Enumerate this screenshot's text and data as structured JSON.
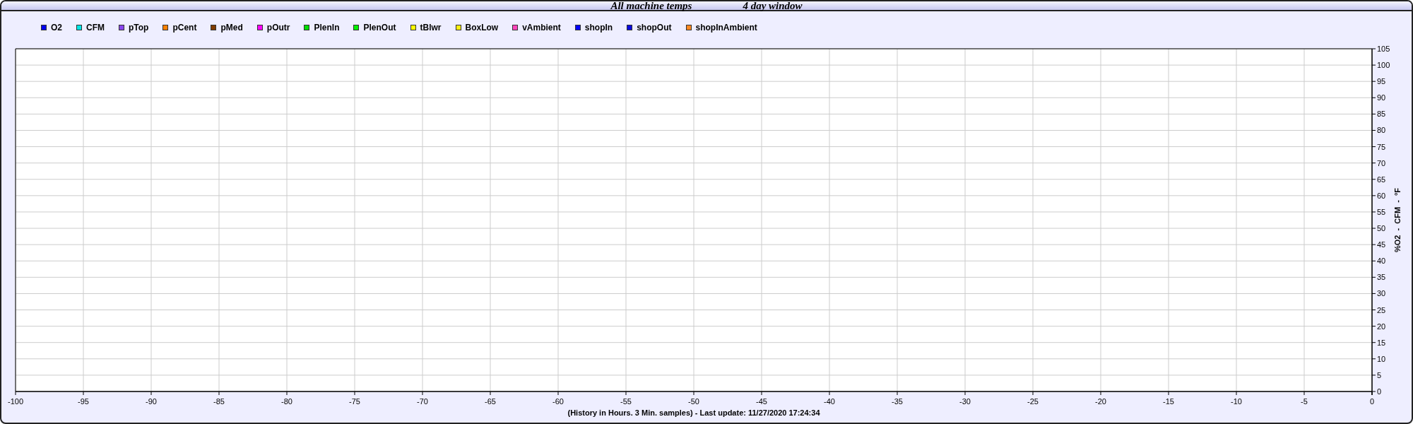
{
  "title": {
    "parts": [
      "All machine temps",
      "4 day window"
    ]
  },
  "chart_data": {
    "type": "line",
    "xlabel": "(History in Hours. 3 Min. samples) - Last update: 11/27/2020 17:24:34",
    "ylabel": "%O2  -  CFM  -  °F",
    "ylim": [
      0,
      105
    ],
    "grid": true,
    "categories": [
      "-100",
      "-95",
      "-90",
      "-85",
      "-80",
      "-75",
      "-70",
      "-65",
      "-60",
      "-55",
      "-50",
      "-45",
      "-40",
      "-35",
      "-30",
      "-25",
      "-20",
      "-15",
      "-10",
      "-5",
      "0"
    ],
    "yticks": [
      0,
      5,
      10,
      15,
      20,
      25,
      30,
      35,
      40,
      45,
      50,
      55,
      60,
      65,
      70,
      75,
      80,
      85,
      90,
      95,
      100,
      105
    ],
    "series": [
      {
        "name": "O2",
        "color": "#0000ee",
        "values": [
          null,
          null,
          null,
          null,
          null,
          null,
          null,
          null,
          null,
          null,
          null,
          null,
          null,
          null,
          null,
          null,
          null,
          null,
          null,
          null,
          null
        ]
      },
      {
        "name": "CFM",
        "color": "#00e5e5",
        "values": [
          null,
          null,
          null,
          null,
          null,
          null,
          null,
          null,
          null,
          null,
          null,
          null,
          null,
          null,
          null,
          null,
          null,
          null,
          null,
          null,
          null
        ]
      },
      {
        "name": "pTop",
        "color": "#8844ee",
        "values": [
          null,
          null,
          null,
          null,
          null,
          null,
          null,
          null,
          null,
          null,
          null,
          null,
          null,
          null,
          null,
          null,
          null,
          null,
          null,
          null,
          null
        ]
      },
      {
        "name": "pCent",
        "color": "#ff8000",
        "values": [
          null,
          null,
          null,
          null,
          null,
          null,
          null,
          null,
          null,
          null,
          null,
          null,
          null,
          null,
          null,
          null,
          null,
          null,
          null,
          null,
          null
        ]
      },
      {
        "name": "pMed",
        "color": "#803c00",
        "values": [
          null,
          null,
          null,
          null,
          null,
          null,
          null,
          null,
          null,
          null,
          null,
          null,
          null,
          null,
          null,
          null,
          null,
          null,
          null,
          null,
          null
        ]
      },
      {
        "name": "pOutr",
        "color": "#ff00ff",
        "values": [
          null,
          null,
          null,
          null,
          null,
          null,
          null,
          null,
          null,
          null,
          null,
          null,
          null,
          null,
          null,
          null,
          null,
          null,
          null,
          null,
          null
        ]
      },
      {
        "name": "PlenIn",
        "color": "#00dd00",
        "values": [
          null,
          null,
          null,
          null,
          null,
          null,
          null,
          null,
          null,
          null,
          null,
          null,
          null,
          null,
          null,
          null,
          null,
          null,
          null,
          null,
          null
        ]
      },
      {
        "name": "PlenOut",
        "color": "#00f000",
        "values": [
          null,
          null,
          null,
          null,
          null,
          null,
          null,
          null,
          null,
          null,
          null,
          null,
          null,
          null,
          null,
          null,
          null,
          null,
          null,
          null,
          null
        ]
      },
      {
        "name": "tBlwr",
        "color": "#ffff00",
        "values": [
          null,
          null,
          null,
          null,
          null,
          null,
          null,
          null,
          null,
          null,
          null,
          null,
          null,
          null,
          null,
          null,
          null,
          null,
          null,
          null,
          null
        ]
      },
      {
        "name": "BoxLow",
        "color": "#ffee10",
        "values": [
          null,
          null,
          null,
          null,
          null,
          null,
          null,
          null,
          null,
          null,
          null,
          null,
          null,
          null,
          null,
          null,
          null,
          null,
          null,
          null,
          null
        ]
      },
      {
        "name": "vAmbient",
        "color": "#ff44bb",
        "values": [
          null,
          null,
          null,
          null,
          null,
          null,
          null,
          null,
          null,
          null,
          null,
          null,
          null,
          null,
          null,
          null,
          null,
          null,
          null,
          null,
          null
        ]
      },
      {
        "name": "shopIn",
        "color": "#0000ff",
        "values": [
          null,
          null,
          null,
          null,
          null,
          null,
          null,
          null,
          null,
          null,
          null,
          null,
          null,
          null,
          null,
          null,
          null,
          null,
          null,
          null,
          null
        ]
      },
      {
        "name": "shopOut",
        "color": "#0a0ae0",
        "values": [
          null,
          null,
          null,
          null,
          null,
          null,
          null,
          null,
          null,
          null,
          null,
          null,
          null,
          null,
          null,
          null,
          null,
          null,
          null,
          null,
          null
        ]
      },
      {
        "name": "shopInAmbient",
        "color": "#ff8822",
        "values": [
          null,
          null,
          null,
          null,
          null,
          null,
          null,
          null,
          null,
          null,
          null,
          null,
          null,
          null,
          null,
          null,
          null,
          null,
          null,
          null,
          null
        ]
      }
    ]
  }
}
